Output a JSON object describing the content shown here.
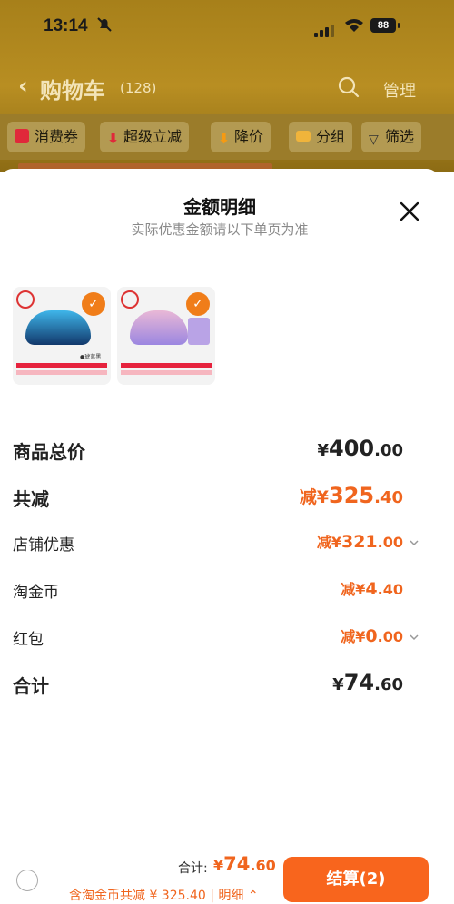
{
  "status_bar": {
    "time": "13:14",
    "battery": "88"
  },
  "nav": {
    "title": "购物车",
    "count": "(128)",
    "manage": "管理"
  },
  "filters": [
    {
      "label": "消费券",
      "icon": "coupon-icon",
      "color": "#e0293a"
    },
    {
      "label": "超级立减",
      "icon": "arrow-down-icon",
      "color": "#e0293a"
    },
    {
      "label": "降价",
      "icon": "price-drop-icon",
      "color": "#f59a12"
    },
    {
      "label": "分组",
      "icon": "folder-icon",
      "color": "#f0b43b"
    },
    {
      "label": "筛选",
      "icon": "filter-icon",
      "color": "#333333"
    }
  ],
  "sheet": {
    "title": "金额明细",
    "subtitle": "实际优惠金额请以下单页为准",
    "products": [
      {
        "name": "product-1",
        "selected": true,
        "accent": "#1d9fd6",
        "tag": "●琥蓝黑"
      },
      {
        "name": "product-2",
        "selected": true,
        "accent": "#b9a3e6",
        "tag": ""
      }
    ],
    "rows": {
      "goods_total": {
        "label": "商品总价",
        "yen": "¥",
        "int": "400",
        "dec": ".00"
      },
      "total_discount": {
        "label": "共减",
        "prefix": "减¥",
        "int": "325",
        "dec": ".40"
      },
      "shop_discount": {
        "label": "店铺优惠",
        "prefix": "减¥",
        "int": "321",
        "dec": ".00"
      },
      "taojinbi": {
        "label": "淘金币",
        "prefix": "减¥",
        "int": "4",
        "dec": ".40"
      },
      "red_packet": {
        "label": "红包",
        "prefix": "减¥",
        "int": "0",
        "dec": ".00"
      },
      "sum": {
        "label": "合计",
        "yen": "¥",
        "int": "74",
        "dec": ".60"
      }
    }
  },
  "bottom": {
    "total_label": "合计:",
    "total_yen": "¥",
    "total_int": "74",
    "total_dec": ".60",
    "detail_text": "含淘金币共减 ¥ 325.40 | 明细",
    "checkout_label": "结算(2)"
  },
  "colors": {
    "accent": "#f0651e",
    "checkout": "#f8651d"
  }
}
